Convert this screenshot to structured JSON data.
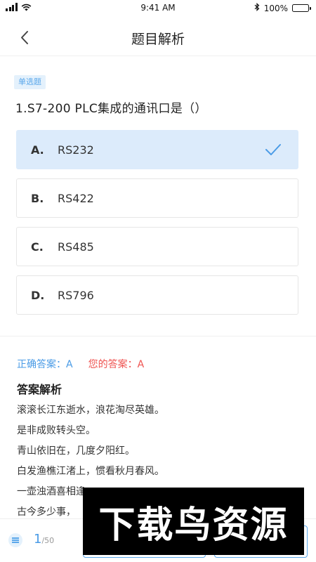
{
  "status_bar": {
    "time": "9:41 AM",
    "battery": "100%"
  },
  "nav": {
    "title": "题目解析"
  },
  "question": {
    "type_tag": "单选题",
    "text": "1.S7-200 PLC集成的通讯口是（）",
    "options": [
      {
        "letter": "A.",
        "text": "RS232",
        "selected": true
      },
      {
        "letter": "B.",
        "text": "RS422",
        "selected": false
      },
      {
        "letter": "C.",
        "text": "RS485",
        "selected": false
      },
      {
        "letter": "D.",
        "text": "RS796",
        "selected": false
      }
    ]
  },
  "answers": {
    "correct": "正确答案：A",
    "yours": "您的答案：A"
  },
  "analysis": {
    "title": "答案解析",
    "lines": [
      "滚滚长江东逝水，浪花淘尽英雄。",
      "是非成败转头空。",
      "青山依旧在，几度夕阳红。",
      "白发渔樵江渚上，惯看秋月春风。",
      "一壶浊酒喜相逢。",
      "古今多少事，"
    ]
  },
  "bottom_bar": {
    "current": "1",
    "total": "/50"
  },
  "watermark": {
    "text": "下载鸟资源"
  },
  "colors": {
    "accent": "#4a9be6",
    "selected_bg": "#dcebfb",
    "error": "#ef5350"
  }
}
